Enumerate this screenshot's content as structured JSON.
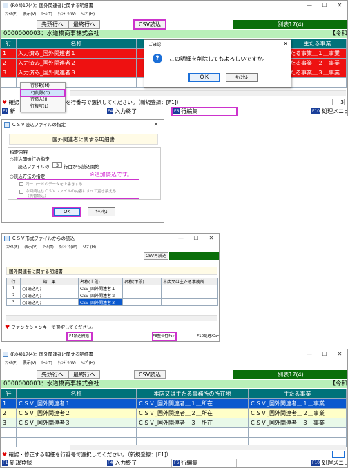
{
  "w1": {
    "title": "(R04)17(4)：国外関連者に関する明細書",
    "menu": [
      "ﾌｧｲﾙ(F)",
      "表示(V)",
      "ﾂｰﾙ(T)",
      "ｳｨﾝﾄﾞｳ(W)",
      "ﾍﾙﾌﾟ(H)"
    ],
    "btn_first": "先頭行へ",
    "btn_last": "最終行へ",
    "btn_csv": "CSV読込",
    "form_label": "別表17(4)",
    "company": "0000000003：水道橋商事株式会社",
    "era": "【令和",
    "headers": [
      "行",
      "名称",
      "主たる事業"
    ],
    "rows": [
      {
        "no": "1",
        "name": "入力済み_国外関連者１",
        "biz": "たる事業＿１＿事業"
      },
      {
        "no": "2",
        "name": "入力済み_国外関連者２",
        "biz": "たる事業＿２＿事業"
      },
      {
        "no": "3",
        "name": "入力済み_国外関連者３",
        "biz": "たる事業＿３＿事業"
      }
    ],
    "status_left": "確認",
    "status_right": "を行番号で選択してください。（新規登録：[F1]）",
    "status_num": "3",
    "fkeys": [
      {
        "k": "F1",
        "label": "新"
      },
      {
        "k": "F4",
        "label": "入力終了"
      },
      {
        "k": "F6",
        "label": "行編集"
      },
      {
        "k": "F10",
        "label": "処理メニュー"
      }
    ],
    "context_menu": [
      "行移動(M)",
      "行削除(D)",
      "行挿入(I)",
      "行複写(L)"
    ],
    "confirm": {
      "title": "ご確認",
      "icon": "?",
      "message": "この明細を削除してもよろしいですか。",
      "ok": "ＯＫ",
      "cancel": "ｷｬﾝｾﾙ"
    }
  },
  "w2": {
    "title": "ＣＳＶ読込ファイルの指定",
    "header": "国外関連者に関する明細書",
    "section": "指定内容",
    "opt_start": "○読込開始行の指定",
    "start_prefix": "読込ファイルの",
    "start_value": "3",
    "start_suffix": "行目から読込開始",
    "opt_method": "○読込方法の指定",
    "note": "※追加読込です。",
    "chk1": "同一コードのデータを上書きする",
    "chk2": "今回読込むＣＳＶファイルの内容にすべて置き換える",
    "chk2b": "（洗替読込）",
    "ok": "OK",
    "cancel": "ｷｬﾝｾﾙ"
  },
  "w3": {
    "title": "ＣＳＶ形式ファイルからの読込",
    "menu": [
      "ﾌｧｲﾙ(F)",
      "表示(V)",
      "ﾂｰﾙ(T)",
      "ｳｨﾝﾄﾞｳ(W)",
      "ﾍﾙﾌﾟ(H)"
    ],
    "btn_reload": "CSV再読込",
    "section": "国外関連者に関する明細書",
    "headers": [
      "行",
      "結　果",
      "名称(上段)",
      "名称(下段)",
      "本店又は主たる事務所"
    ],
    "rows": [
      {
        "no": "1",
        "result": "○(読込可)",
        "name": "CSV_国外関連者１"
      },
      {
        "no": "2",
        "result": "○(読込可)",
        "name": "CSV_国外関連者２"
      },
      {
        "no": "3",
        "result": "○(読込可)",
        "name": "CSV_国外関連者３"
      }
    ],
    "status": "ファンクションキーで選択してください。",
    "fkeys": [
      "F4読込開始",
      "F8整合性ﾁｪｯｸ",
      "F10処理ﾒﾆｭｰ"
    ]
  },
  "w4": {
    "title": "(R04)17(4)：国外関連者に関する明細書",
    "menu": [
      "ﾌｧｲﾙ(F)",
      "表示(V)",
      "ﾂｰﾙ(T)",
      "ｳｨﾝﾄﾞｳ(W)",
      "ﾍﾙﾌﾟ(H)"
    ],
    "btn_first": "先頭行へ",
    "btn_last": "最終行へ",
    "btn_csv": "CSV読込",
    "form_label": "別表17(4)",
    "company": "0000000003：水道橋商事株式会社",
    "era": "【令和",
    "headers": [
      "行",
      "名称",
      "本店又は主たる事務所の所在地",
      "主たる事業"
    ],
    "rows": [
      {
        "no": "1",
        "name": "ＣＳＶ_国外関連者１",
        "addr": "ＣＳＶ_国外関連者＿１＿所在",
        "biz": "ＣＳＶ_国外関連者＿１＿事業"
      },
      {
        "no": "2",
        "name": "ＣＳＶ_国外関連者２",
        "addr": "ＣＳＶ_国外関連者＿２＿所在",
        "biz": "ＣＳＶ_国外関連者＿２＿事業"
      },
      {
        "no": "3",
        "name": "ＣＳＶ_国外関連者３",
        "addr": "ＣＳＶ_国外関連者＿３＿所在",
        "biz": "ＣＳＶ_国外関連者＿３＿事業"
      }
    ],
    "status": "確認・修正する明細を行番号で選択してください。（新規登録：[F1]）",
    "fkeys": [
      {
        "k": "F1",
        "label": "新規登録"
      },
      {
        "k": "F4",
        "label": "入力終了"
      },
      {
        "k": "F6",
        "label": "行編集"
      },
      {
        "k": "F10",
        "label": "処理メニュー"
      }
    ]
  }
}
